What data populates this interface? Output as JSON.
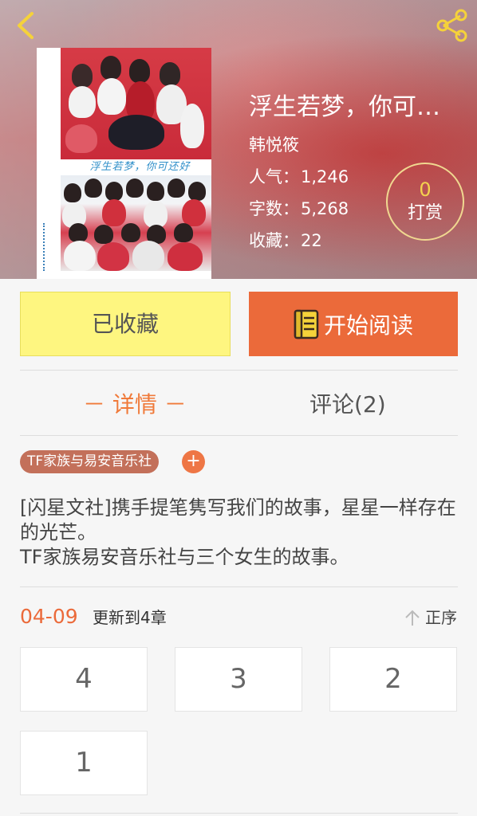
{
  "book": {
    "title": "浮生若梦，你可…",
    "author": "韩悦筱",
    "cover_caption": "浮生若梦，你可还好",
    "stats": {
      "popularity_label": "人气：",
      "popularity_value": "1,246",
      "words_label": "字数：",
      "words_value": "5,268",
      "favorites_label": "收藏：",
      "favorites_value": "22"
    },
    "tip": {
      "count": "0",
      "label": "打赏"
    }
  },
  "actions": {
    "collected_label": "已收藏",
    "read_label": "开始阅读"
  },
  "tabs": {
    "detail_label": "－ 详情 －",
    "comment_label": "评论(2)"
  },
  "tags": {
    "items": [
      "TF家族与易安音乐社"
    ],
    "add_symbol": "+"
  },
  "description": {
    "line1": "[闪星文社]携手提笔隽写我们的故事，星星一样存在的光芒。",
    "line2": "TF家族易安音乐社与三个女生的故事。"
  },
  "updates": {
    "date": "04-09",
    "text": "更新到4章",
    "sort_label": "正序"
  },
  "chapters": [
    "4",
    "3",
    "2",
    "1"
  ],
  "colors": {
    "accent_orange": "#eb6a3a",
    "collected_yellow": "#fef680",
    "tag_brown": "#c3705a",
    "tip_gold": "#f3d24e"
  },
  "icons": {
    "back": "chevron-left-icon",
    "share": "share-icon",
    "book": "book-icon",
    "sort": "arrow-up-icon"
  }
}
